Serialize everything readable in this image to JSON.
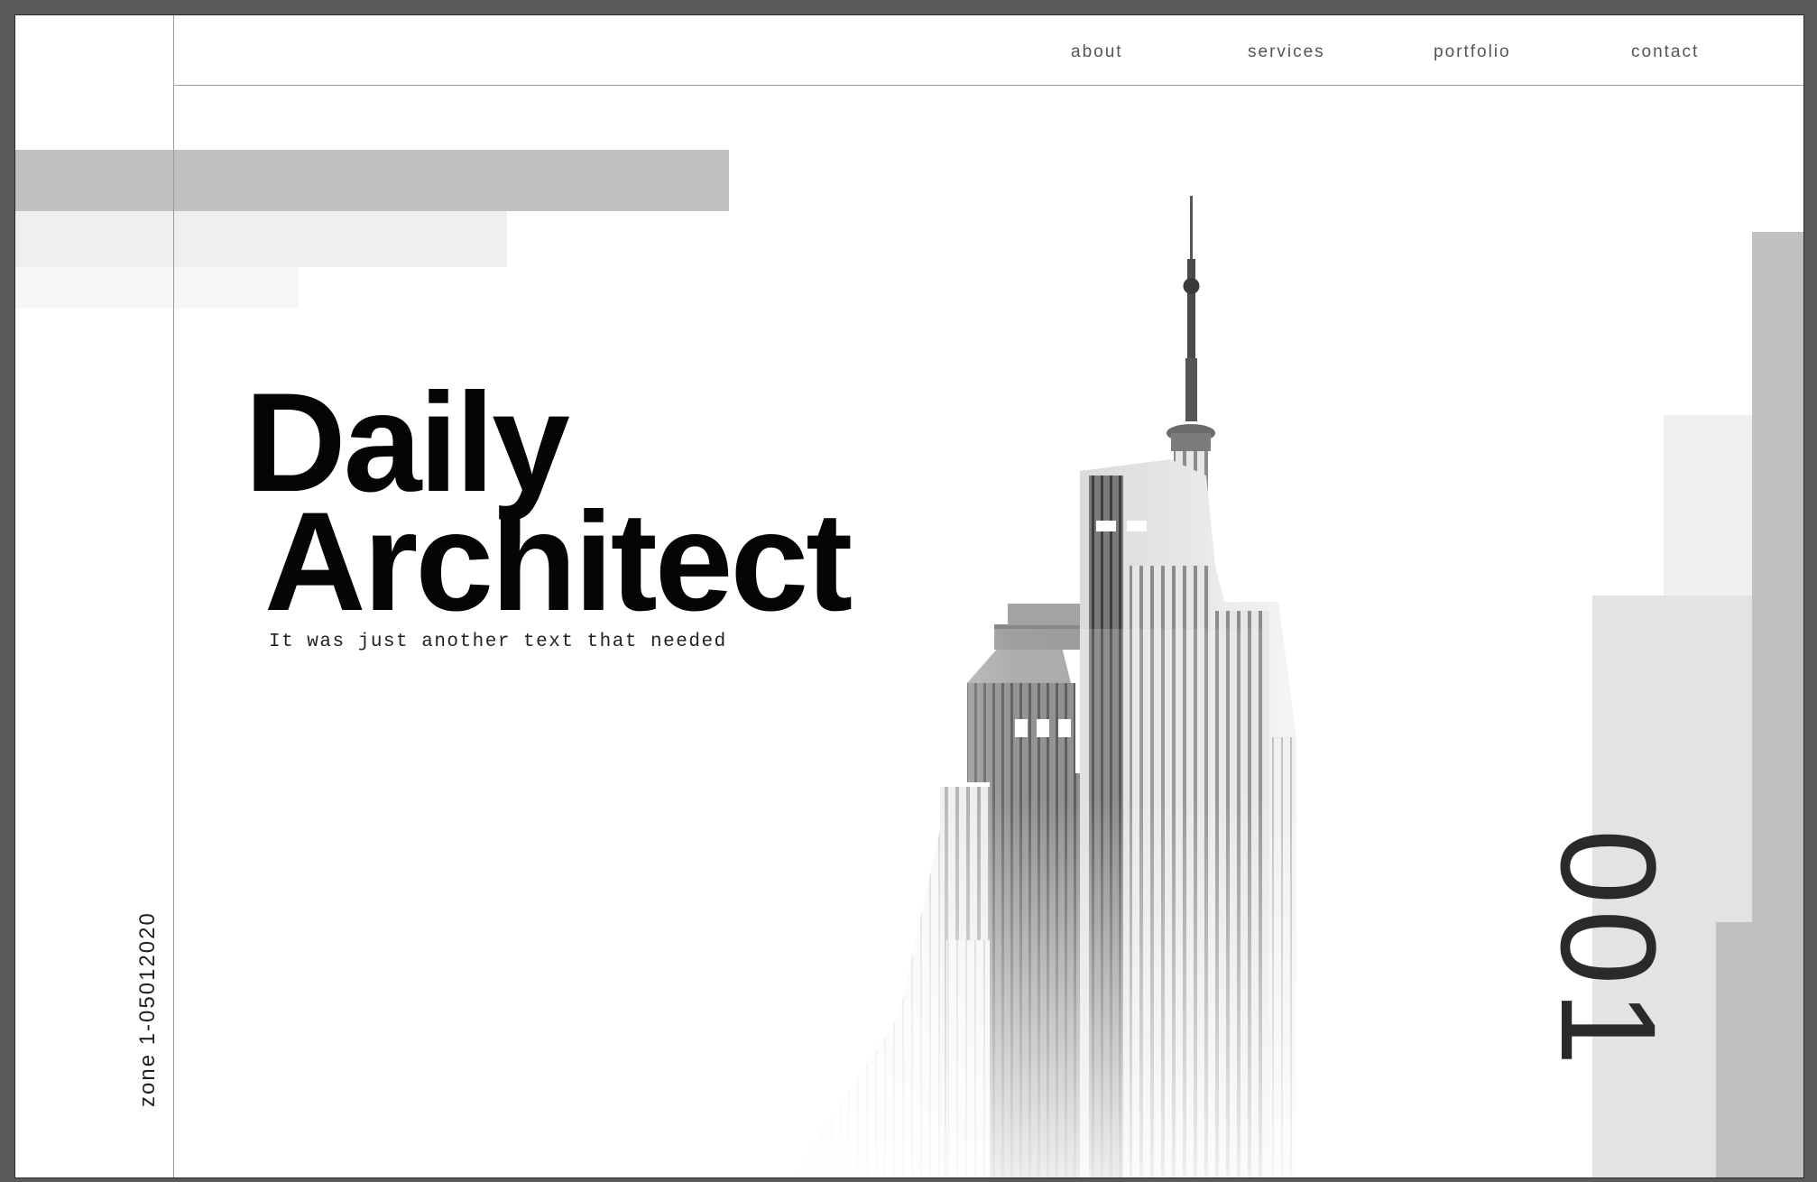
{
  "nav": {
    "items": [
      {
        "label": "about"
      },
      {
        "label": "services"
      },
      {
        "label": "portfolio"
      },
      {
        "label": "contact"
      }
    ]
  },
  "hero": {
    "title_line1": "Daily",
    "title_line2": "Architect",
    "subtitle": "It was just another text that needed"
  },
  "side": {
    "zone_text": "zone 1-05012020"
  },
  "number": "001",
  "colors": {
    "frame": "#5a5a5a",
    "background": "#ffffff",
    "text": "#050505",
    "accent_gray": "#c1c1c1",
    "light_gray": "#efefef"
  },
  "icons": {
    "building": "skyscraper-illustration"
  }
}
